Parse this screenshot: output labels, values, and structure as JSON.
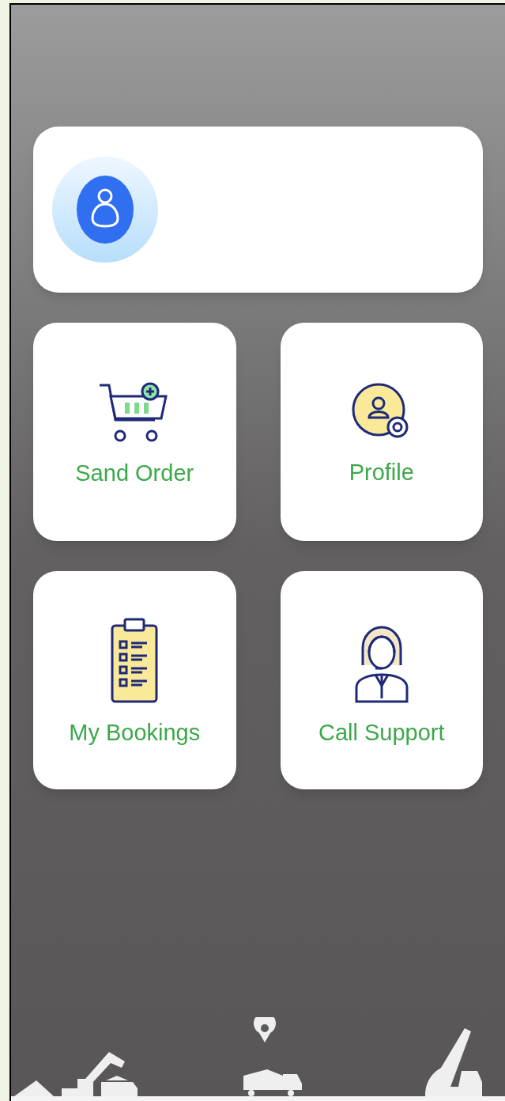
{
  "tiles": [
    {
      "kind": "cart",
      "label": "Sand Order"
    },
    {
      "kind": "profile",
      "label": "Profile"
    },
    {
      "kind": "clipboard",
      "label": "My Bookings"
    },
    {
      "kind": "support",
      "label": "Call Support"
    }
  ]
}
